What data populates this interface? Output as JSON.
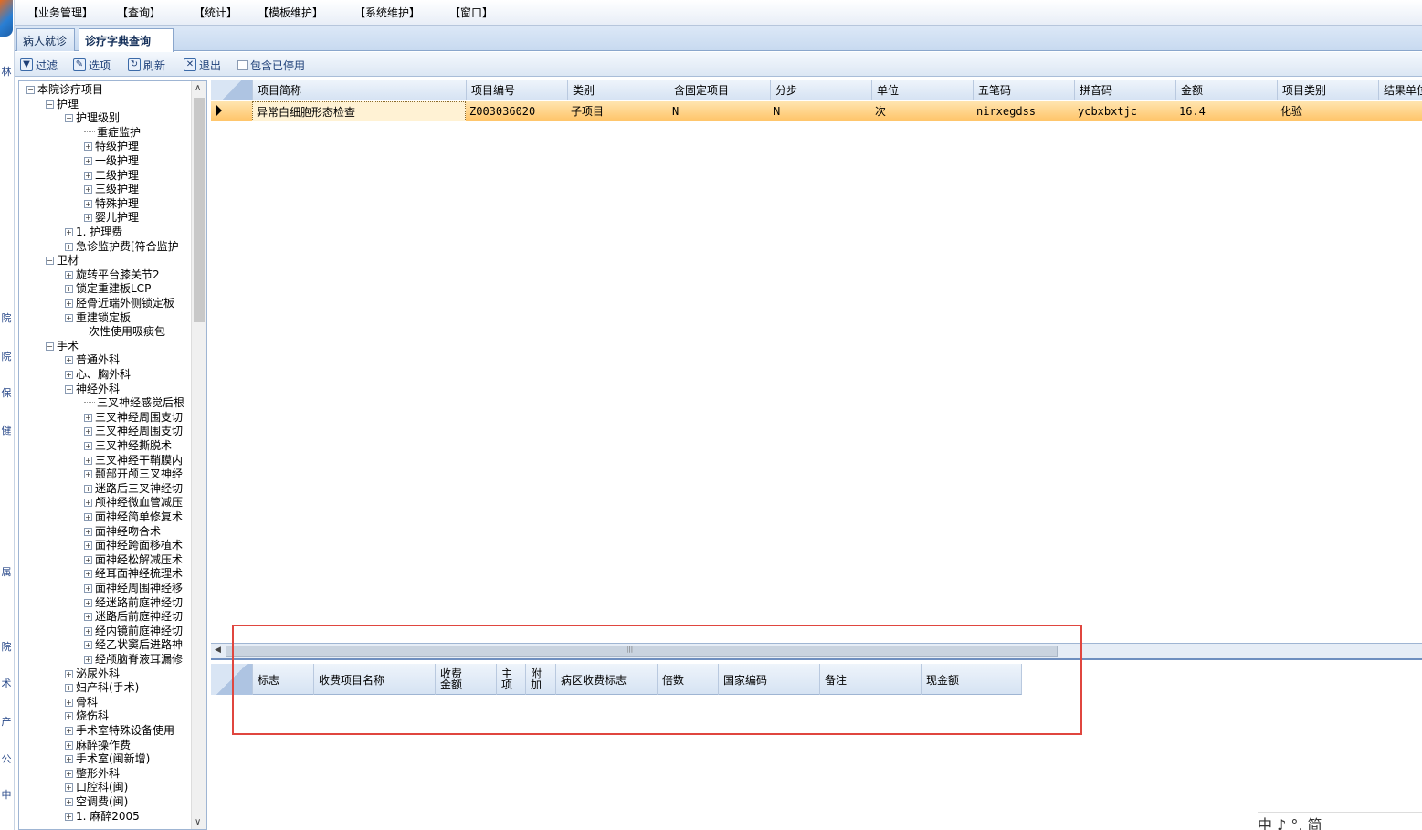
{
  "menu": [
    "【业务管理】",
    "【查询】",
    "【统计】",
    "【模板维护】",
    "【系统维护】",
    "【窗口】"
  ],
  "tabs": [
    "病人就诊",
    "诊疗字典查询"
  ],
  "toolbar": {
    "filter": "过滤",
    "options": "选项",
    "refresh": "刷新",
    "exit": "退出",
    "include_disabled": "包含已停用"
  },
  "left_strip": [
    "林",
    "院",
    "院",
    "保",
    "健",
    "属",
    "院",
    "术",
    "产",
    "公",
    "中"
  ],
  "tree": [
    {
      "label": "本院诊疗项目",
      "level": 0,
      "toggle": "-"
    },
    {
      "label": "护理",
      "level": 1,
      "toggle": "-"
    },
    {
      "label": "护理级别",
      "level": 2,
      "toggle": "-"
    },
    {
      "label": "重症监护",
      "level": 3,
      "toggle": ""
    },
    {
      "label": "特级护理",
      "level": 3,
      "toggle": "+"
    },
    {
      "label": "一级护理",
      "level": 3,
      "toggle": "+"
    },
    {
      "label": "二级护理",
      "level": 3,
      "toggle": "+"
    },
    {
      "label": "三级护理",
      "level": 3,
      "toggle": "+"
    },
    {
      "label": "特殊护理",
      "level": 3,
      "toggle": "+"
    },
    {
      "label": "婴儿护理",
      "level": 3,
      "toggle": "+"
    },
    {
      "label": "1. 护理费",
      "level": 2,
      "toggle": "+"
    },
    {
      "label": "急诊监护费[符合监护",
      "level": 2,
      "toggle": "+"
    },
    {
      "label": "卫材",
      "level": 1,
      "toggle": "-"
    },
    {
      "label": "旋转平台膝关节2",
      "level": 2,
      "toggle": "+"
    },
    {
      "label": "锁定重建板LCP",
      "level": 2,
      "toggle": "+"
    },
    {
      "label": "胫骨近端外侧锁定板",
      "level": 2,
      "toggle": "+"
    },
    {
      "label": "重建锁定板",
      "level": 2,
      "toggle": "+"
    },
    {
      "label": "一次性使用吸痰包",
      "level": 2,
      "toggle": ""
    },
    {
      "label": "手术",
      "level": 1,
      "toggle": "-"
    },
    {
      "label": "普通外科",
      "level": 2,
      "toggle": "+"
    },
    {
      "label": "心、胸外科",
      "level": 2,
      "toggle": "+"
    },
    {
      "label": "神经外科",
      "level": 2,
      "toggle": "-"
    },
    {
      "label": "三叉神经感觉后根",
      "level": 3,
      "toggle": ""
    },
    {
      "label": "三叉神经周围支切",
      "level": 3,
      "toggle": "+"
    },
    {
      "label": "三叉神经周围支切",
      "level": 3,
      "toggle": "+"
    },
    {
      "label": "三叉神经撕脱术",
      "level": 3,
      "toggle": "+"
    },
    {
      "label": "三叉神经干鞘膜内",
      "level": 3,
      "toggle": "+"
    },
    {
      "label": "颞部开颅三叉神经",
      "level": 3,
      "toggle": "+"
    },
    {
      "label": "迷路后三叉神经切",
      "level": 3,
      "toggle": "+"
    },
    {
      "label": "颅神经微血管减压",
      "level": 3,
      "toggle": "+"
    },
    {
      "label": "面神经简单修复术",
      "level": 3,
      "toggle": "+"
    },
    {
      "label": "面神经吻合术",
      "level": 3,
      "toggle": "+"
    },
    {
      "label": "面神经跨面移植术",
      "level": 3,
      "toggle": "+"
    },
    {
      "label": "面神经松解减压术",
      "level": 3,
      "toggle": "+"
    },
    {
      "label": "经耳面神经梳理术",
      "level": 3,
      "toggle": "+"
    },
    {
      "label": "面神经周围神经移",
      "level": 3,
      "toggle": "+"
    },
    {
      "label": "经迷路前庭神经切",
      "level": 3,
      "toggle": "+"
    },
    {
      "label": "迷路后前庭神经切",
      "level": 3,
      "toggle": "+"
    },
    {
      "label": "经内镜前庭神经切",
      "level": 3,
      "toggle": "+"
    },
    {
      "label": "经乙状窦后进路神",
      "level": 3,
      "toggle": "+"
    },
    {
      "label": "经颅脑脊液耳漏修",
      "level": 3,
      "toggle": "+"
    },
    {
      "label": "泌尿外科",
      "level": 2,
      "toggle": "+"
    },
    {
      "label": "妇产科(手术)",
      "level": 2,
      "toggle": "+"
    },
    {
      "label": "骨科",
      "level": 2,
      "toggle": "+"
    },
    {
      "label": "烧伤科",
      "level": 2,
      "toggle": "+"
    },
    {
      "label": "手术室特殊设备使用",
      "level": 2,
      "toggle": "+"
    },
    {
      "label": "麻醉操作费",
      "level": 2,
      "toggle": "+"
    },
    {
      "label": "手术室(闽新增)",
      "level": 2,
      "toggle": "+"
    },
    {
      "label": "整形外科",
      "level": 2,
      "toggle": "+"
    },
    {
      "label": "口腔科(闽)",
      "level": 2,
      "toggle": "+"
    },
    {
      "label": "空调费(闽)",
      "level": 2,
      "toggle": "+"
    },
    {
      "label": "1. 麻醉2005",
      "level": 2,
      "toggle": "+"
    }
  ],
  "main_grid": {
    "headers": [
      "项目简称",
      "项目编号",
      "类别",
      "含固定项目",
      "分步",
      "单位",
      "五笔码",
      "拼音码",
      "金额",
      "项目类别",
      "结果单位"
    ],
    "rows": [
      [
        "异常白细胞形态检查",
        "Z003036020",
        "子项目",
        "N",
        "N",
        "次",
        "nirxegdss",
        "ycbxbxtjc",
        "16.4",
        "化验",
        ""
      ]
    ]
  },
  "sub_grid": {
    "headers": [
      "标志",
      "收费项目名称",
      "收费\n金额",
      "主\n项",
      "附\n加",
      "病区收费标志",
      "倍数",
      "国家编码",
      "备注",
      "现金额"
    ]
  },
  "ime_bar": "中 ♪ °, 简"
}
